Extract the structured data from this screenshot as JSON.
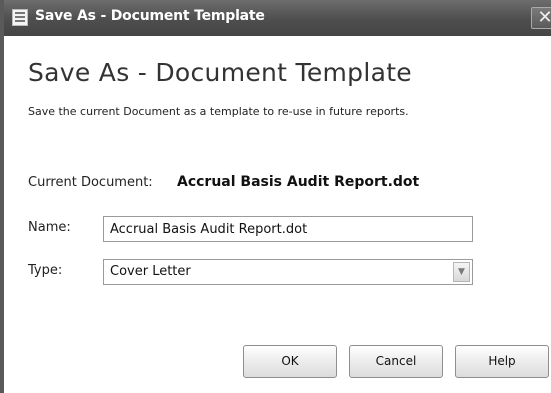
{
  "window": {
    "title": "Save As - Document Template",
    "close_glyph": "✕"
  },
  "dialog": {
    "heading": "Save As - Document Template",
    "description": "Save the current Document as a template to re-use in future reports.",
    "current_document_label": "Current Document:",
    "current_document_value": "Accrual Basis Audit Report.dot",
    "name_label": "Name:",
    "name_value": "Accrual Basis Audit Report.dot",
    "type_label": "Type:",
    "type_value": "Cover Letter",
    "dropdown_glyph": "▼"
  },
  "buttons": {
    "ok": "OK",
    "cancel": "Cancel",
    "help": "Help"
  },
  "icons": {
    "title": "document-template-icon",
    "close": "close-icon",
    "dropdown": "chevron-down-icon"
  }
}
